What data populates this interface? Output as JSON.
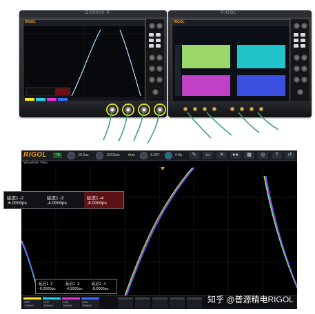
{
  "photo": {
    "left_brand": "RIGOL",
    "right_brand": "RIGOL",
    "left_title": "DS8000-R",
    "right_title": "RIGOL"
  },
  "scope": {
    "logo": "RIGOL",
    "run_state": "T'D",
    "toolbar": {
      "horizontal": "10.0ns",
      "sample": "10GSa/s",
      "memory": "Auto",
      "trigger_mode": "Edge",
      "trigger_level": "0.00V",
      "channel_scale": "4 Mv"
    },
    "window_label": "Waveform View",
    "delay_panel": {
      "items": [
        {
          "label": "延迟1 -2",
          "value": "-6.0000ps",
          "highlight": false
        },
        {
          "label": "延迟1 -3",
          "value": "-4.0000ps",
          "highlight": false
        },
        {
          "label": "延迟1 -4",
          "value": "-8.0000ps",
          "highlight": true
        }
      ]
    },
    "screen_annotation": {
      "items": [
        {
          "label": "延迟1 -2",
          "value": "-6.0000ps"
        },
        {
          "label": "延迟1 -3",
          "value": "-4.0000ps"
        },
        {
          "label": "延迟1 -4",
          "value": "-8.0000ps"
        }
      ]
    },
    "status_channels": [
      {
        "name": "CH1",
        "line1": "100mV/",
        "line2": "0.00V",
        "color": "#f5e81c"
      },
      {
        "name": "CH2",
        "line1": "100mV/",
        "line2": "0.00V",
        "color": "#27d3f2"
      },
      {
        "name": "CH3",
        "line1": "100mV/",
        "line2": "0.00V",
        "color": "#e534d8"
      },
      {
        "name": "CH4",
        "line1": "100mV/",
        "line2": "0.00V",
        "color": "#3a6cff"
      }
    ]
  },
  "watermark": "知乎 @普源精电RIGOL",
  "colors": {
    "ch1": "#f5e81c",
    "ch2": "#27d3f2",
    "ch3": "#e534d8",
    "ch4": "#3a6cff",
    "logo": "#f39c12"
  }
}
